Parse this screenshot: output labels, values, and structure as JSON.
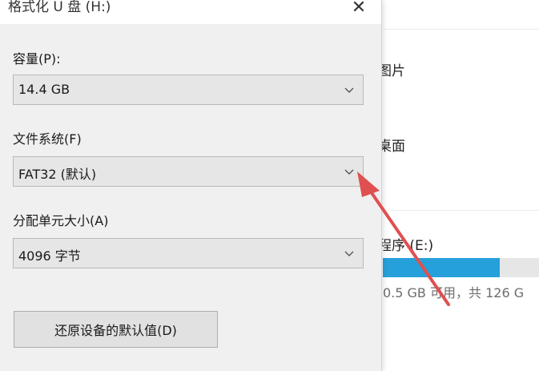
{
  "dialog": {
    "title": "格式化 U 盘 (H:)",
    "close_glyph": "✕",
    "capacity_label": "容量(P):",
    "capacity_value": "14.4 GB",
    "filesystem_label": "文件系统(F)",
    "filesystem_value": "FAT32 (默认)",
    "allocation_label": "分配单元大小(A)",
    "allocation_value": "4096 字节",
    "restore_button": "还原设备的默认值(D)"
  },
  "background": {
    "item_pictures": "图片",
    "item_desktop": "桌面",
    "drive_label": "程序 (E:)",
    "drive_free": "0.5 GB 可用，共 126 G",
    "drive_used_fraction": 0.75,
    "drive_bar_color": "#26a0da"
  },
  "annotation": {
    "arrow_color": "#e05050"
  },
  "icons": [
    "close-icon",
    "chevron-down-icon"
  ]
}
